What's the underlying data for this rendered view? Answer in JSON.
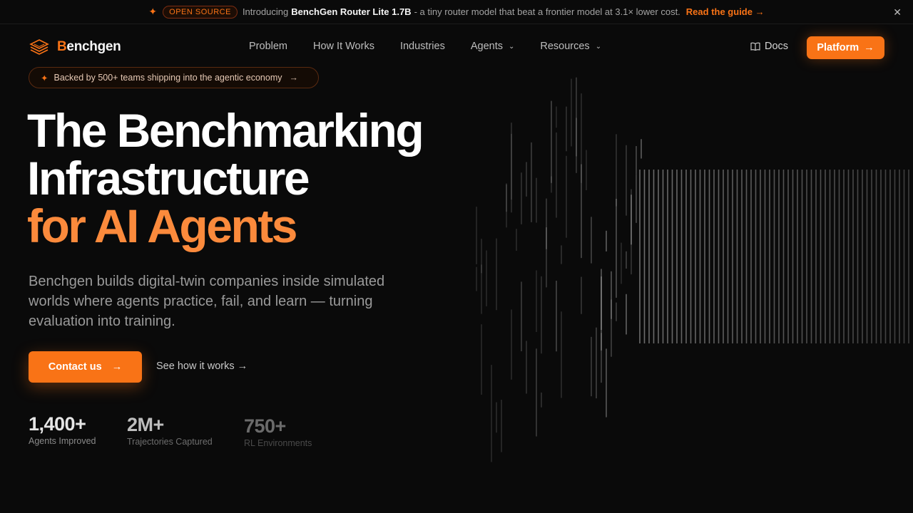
{
  "announcement": {
    "badge": "OPEN SOURCE",
    "intro": "Introducing",
    "product": "BenchGen Router Lite 1.7B",
    "description": "- a tiny router model that beat a frontier model at 3.1× lower cost.",
    "link": "Read the guide →",
    "close": "✕"
  },
  "nav": {
    "logo_initial": "B",
    "logo_rest": "enchgen",
    "items": [
      {
        "label": "Problem"
      },
      {
        "label": "How It Works"
      },
      {
        "label": "Industries"
      },
      {
        "label": "Agents",
        "dropdown": true
      },
      {
        "label": "Resources",
        "dropdown": true
      }
    ],
    "docs": "Docs",
    "platform": "Platform"
  },
  "hero": {
    "badge": "Backed by 500+ teams shipping into the agentic economy",
    "headline_line1": "The Benchmarking",
    "headline_line2": "Infrastructure",
    "headline_line3": "for AI Agents",
    "subtitle": "Benchgen builds digital-twin companies inside simulated worlds where agents practice, fail, and learn — turning evaluation into training.",
    "primary_cta": "Contact us",
    "secondary_cta": "See how it works →"
  },
  "stats": [
    {
      "value": "1,400+",
      "label": "Agents Improved"
    },
    {
      "value": "2M+",
      "label": "Trajectories Captured"
    },
    {
      "value": "750+",
      "label": "RL Environments"
    }
  ],
  "colors": {
    "accent": "#f97316",
    "accent_light": "#fb8a3c",
    "background": "#0a0a0a"
  },
  "icons": {
    "sparkle": "sparkle-icon",
    "logo": "layers-icon",
    "docs": "book-icon",
    "arrow": "arrow-right-icon",
    "chevron": "chevron-down-icon",
    "close": "close-icon"
  }
}
